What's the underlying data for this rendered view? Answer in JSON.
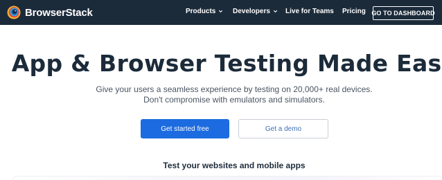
{
  "navbar": {
    "brand": "BrowserStack",
    "items": [
      {
        "label": "Products",
        "has_dropdown": true
      },
      {
        "label": "Developers",
        "has_dropdown": true
      },
      {
        "label": "Live for Teams",
        "has_dropdown": false
      },
      {
        "label": "Pricing",
        "has_dropdown": false
      }
    ],
    "cta": "GO TO DASHBOARD"
  },
  "hero": {
    "title": "App & Browser Testing Made Easy",
    "subtitle_line1": "Give your users a seamless experience by testing on 20,000+ real devices.",
    "subtitle_line2": "Don't compromise with emulators and simulators.",
    "primary_button": "Get started free",
    "secondary_button": "Get a demo"
  },
  "section": {
    "heading": "Test your websites and mobile apps"
  },
  "colors": {
    "nav_background": "#1c2b3a",
    "primary": "#1c6be0",
    "heading": "#1c2b3a"
  },
  "icons": {
    "logo": "browserstack-logo-icon",
    "dropdown": "chevron-down-icon"
  }
}
